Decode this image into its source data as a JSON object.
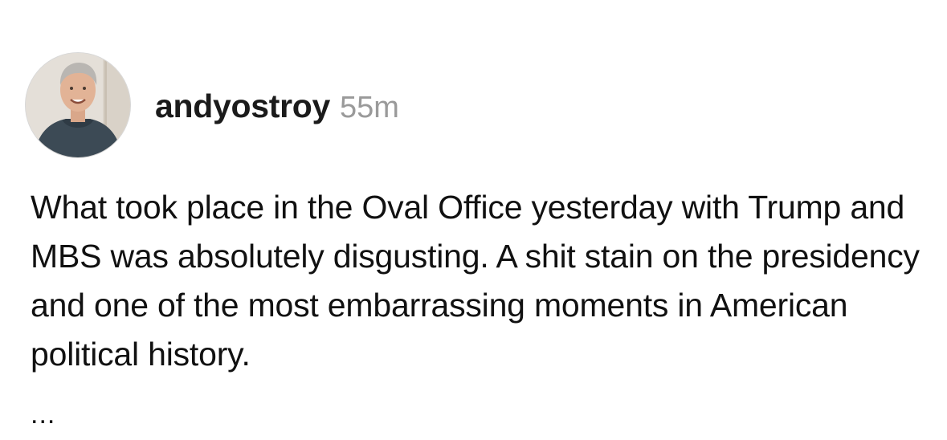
{
  "post": {
    "username": "andyostroy",
    "timestamp": "55m",
    "text": "What took place in the Oval Office yesterday with Trump and MBS was absolutely disgusting. A shit stain on the presidency and one of the most embarrassing moments in American political history.",
    "more": "...",
    "avatar_icon": "profile-photo"
  }
}
